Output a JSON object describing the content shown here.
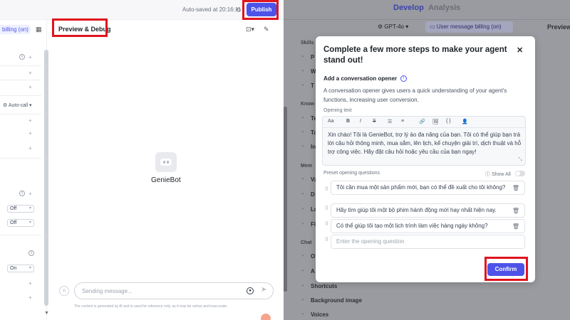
{
  "left_panel": {
    "autosave_text": "Auto-saved at 20:16:11",
    "history_icon": "history-icon",
    "publish_label": "Publish",
    "billing_chip": "billing (on)",
    "autocall_label": "Auto-call",
    "selects": [
      "Off",
      "Off",
      "On"
    ],
    "preview_title": "Preview & Debug",
    "bot_name": "GenieBot",
    "message_placeholder": "Sending message...",
    "disclaimer": "The content is generated by AI and is used for reference only, as it may be untrue and inaccurate."
  },
  "right_panel": {
    "tab_develop": "Develop",
    "tab_analysis": "Analysis",
    "model": "GPT-4o",
    "billing": "User message billing (on)",
    "preview": "Preview",
    "sidebar": {
      "skills_label": "Skills",
      "knowledge_label": "Know",
      "memory_label": "Mem",
      "chat_label": "Chat",
      "items_visible": [
        "P",
        "W",
        "T",
        "Te",
        "Ta",
        "In",
        "Va",
        "D",
        "Lo",
        "Fi",
        "O",
        "A"
      ],
      "shortcuts": "Shortcuts",
      "background_image": "Background image",
      "voices": "Voices"
    }
  },
  "modal": {
    "title": "Complete a few more steps to make your agent stand out!",
    "section_title": "Add a conversation opener",
    "description": "A conversation opener gives users a quick understanding of your agent's functions, increasing user conversion.",
    "opening_text_label": "Opening text",
    "toolbar": [
      "Aa",
      "B",
      "I",
      "S",
      "☰",
      "≡",
      "🔗",
      "🖼",
      "{ }",
      "👤"
    ],
    "opening_text": "Xin chào! Tôi là GenieBot, trợ lý ảo đa năng của bạn. Tôi có thể giúp bạn trả lời câu hỏi thông minh, mua sắm, lên lịch, kể chuyện giải trí, dịch thuật và hỗ trợ công việc. Hãy đặt câu hỏi hoặc yêu cầu của bạn ngay!",
    "preset_label": "Preset opening questions",
    "show_all": "Show All",
    "questions": [
      "Tôi cần mua một sản phẩm mới, bạn có thể đề xuất cho tôi không?",
      "Hãy tìm giúp tôi một bộ phim hành động mới hay nhất hiện nay.",
      "Có thể giúp tôi tạo một lịch trình làm việc hàng ngày không?"
    ],
    "question_placeholder": "Enter the opening question",
    "confirm_label": "Confirm"
  },
  "colors": {
    "accent": "#4d53e8",
    "highlight_box": "#e0141e",
    "overlay": "#9a9ba0"
  }
}
